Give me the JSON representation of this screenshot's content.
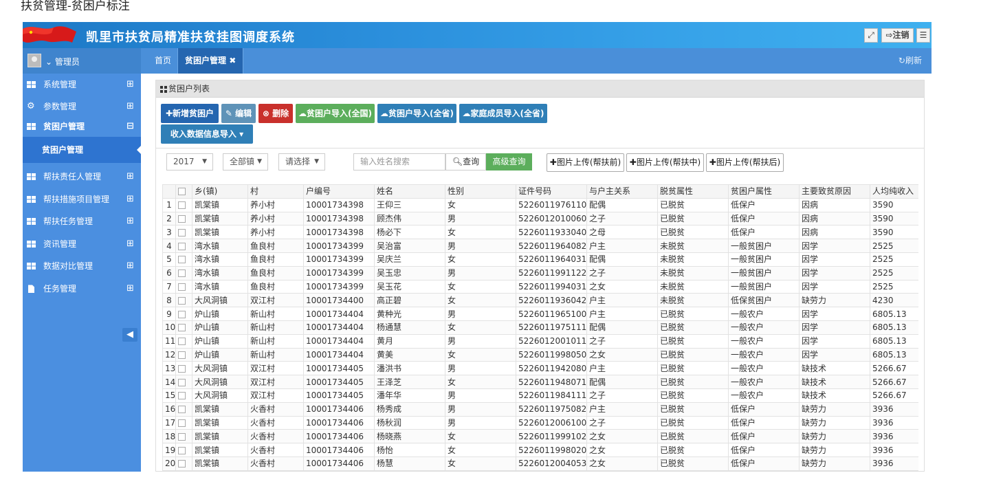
{
  "caption": "扶贫管理-贫困户标注",
  "header": {
    "title": "凯里市扶贫局精准扶贫挂图调度系统",
    "fullscreen_icon": "expand-icon",
    "logout_label": "注销",
    "menu_icon": "hamburger-icon"
  },
  "user": {
    "label": "管理员"
  },
  "tabs": {
    "home": "首页",
    "active": "贫困户管理"
  },
  "refresh": "刷新",
  "sidebar": {
    "items": [
      {
        "label": "系统管理"
      },
      {
        "label": "参数管理"
      },
      {
        "label": "贫困户管理"
      },
      {
        "label": "帮扶责任人管理"
      },
      {
        "label": "帮扶措施项目管理"
      },
      {
        "label": "帮扶任务管理"
      },
      {
        "label": "资讯管理"
      },
      {
        "label": "数据对比管理"
      },
      {
        "label": "任务管理"
      }
    ],
    "sub_active": "贫困户管理"
  },
  "panel": {
    "title": "贫困户列表"
  },
  "actions": {
    "add": "新增贫困户",
    "edit": "编辑",
    "delete": "删除",
    "import_all": "贫困户导入(全国)",
    "import_prov": "贫困户导入(全省)",
    "import_family": "家庭成员导入(全省)",
    "income": "收入数据信息导入"
  },
  "filters": {
    "year": "2017",
    "town": "全部镇",
    "choose": "请选择",
    "search_placeholder": "输入姓名搜索",
    "query": "查询",
    "advanced": "高级查询",
    "upload_before": "图片上传(帮扶前)",
    "upload_mid": "图片上传(帮扶中)",
    "upload_after": "图片上传(帮扶后)"
  },
  "table": {
    "headers": [
      "乡(镇)",
      "村",
      "户编号",
      "姓名",
      "性别",
      "证件号码",
      "与户主关系",
      "脱贫属性",
      "贫困户属性",
      "主要致贫原因",
      "人均纯收入"
    ],
    "rows": [
      [
        "1",
        "凯棠镇",
        "养小村",
        "10001734398",
        "王仰三",
        "女",
        "52260119761104",
        "配偶",
        "已脱贫",
        "低保户",
        "因病",
        "3590"
      ],
      [
        "2",
        "凯棠镇",
        "养小村",
        "10001734398",
        "顾杰伟",
        "男",
        "52260120100605(",
        "之子",
        "已脱贫",
        "低保户",
        "因病",
        "3590"
      ],
      [
        "3",
        "凯棠镇",
        "养小村",
        "10001734398",
        "杨必下",
        "女",
        "52260119330408",
        "之母",
        "已脱贫",
        "低保户",
        "因病",
        "3590"
      ],
      [
        "4",
        "湾水镇",
        "鱼良村",
        "10001734399",
        "吴治富",
        "男",
        "52260119640826",
        "户主",
        "未脱贫",
        "一般贫困户",
        "因学",
        "2525"
      ],
      [
        "5",
        "湾水镇",
        "鱼良村",
        "10001734399",
        "吴庆兰",
        "女",
        "52260119640310",
        "配偶",
        "未脱贫",
        "一般贫困户",
        "因学",
        "2525"
      ],
      [
        "6",
        "湾水镇",
        "鱼良村",
        "10001734399",
        "吴玉忠",
        "男",
        "52260119911228",
        "之子",
        "未脱贫",
        "一般贫困户",
        "因学",
        "2525"
      ],
      [
        "7",
        "湾水镇",
        "鱼良村",
        "10001734399",
        "吴玉花",
        "女",
        "52260119940312",
        "之女",
        "未脱贫",
        "一般贫困户",
        "因学",
        "2525"
      ],
      [
        "8",
        "大风洞镇",
        "双江村",
        "10001734400",
        "高正碧",
        "女",
        "52260119360426",
        "户主",
        "未脱贫",
        "低保贫困户",
        "缺劳力",
        "4230"
      ],
      [
        "9",
        "炉山镇",
        "新山村",
        "10001734404",
        "黄种光",
        "男",
        "52260119651006",
        "户主",
        "已脱贫",
        "一般农户",
        "因学",
        "6805.13"
      ],
      [
        "10",
        "炉山镇",
        "新山村",
        "10001734404",
        "杨通慧",
        "女",
        "52260119751113",
        "配偶",
        "已脱贫",
        "一般农户",
        "因学",
        "6805.13"
      ],
      [
        "11",
        "炉山镇",
        "新山村",
        "10001734404",
        "黄月",
        "男",
        "52260120010115",
        "之子",
        "已脱贫",
        "一般农户",
        "因学",
        "6805.13"
      ],
      [
        "12",
        "炉山镇",
        "新山村",
        "10001734404",
        "黄美",
        "女",
        "52260119980504",
        "之女",
        "已脱贫",
        "一般农户",
        "因学",
        "6805.13"
      ],
      [
        "13",
        "大风洞镇",
        "双江村",
        "10001734405",
        "潘洪书",
        "男",
        "52260119420807",
        "户主",
        "已脱贫",
        "一般农户",
        "缺技术",
        "5266.67"
      ],
      [
        "14",
        "大风洞镇",
        "双江村",
        "10001734405",
        "王泽芝",
        "女",
        "52260119480714",
        "配偶",
        "已脱贫",
        "一般农户",
        "缺技术",
        "5266.67"
      ],
      [
        "15",
        "大风洞镇",
        "双江村",
        "10001734405",
        "潘年华",
        "男",
        "52260119841110",
        "之子",
        "已脱贫",
        "一般农户",
        "缺技术",
        "5266.67"
      ],
      [
        "16",
        "凯棠镇",
        "火香村",
        "10001734406",
        "杨秀成",
        "男",
        "52260119750828",
        "户主",
        "已脱贫",
        "低保户",
        "缺劳力",
        "3936"
      ],
      [
        "17",
        "凯棠镇",
        "火香村",
        "10001734406",
        "杨秋润",
        "男",
        "52260120061006(",
        "之子",
        "已脱贫",
        "低保户",
        "缺劳力",
        "3936"
      ],
      [
        "18",
        "凯棠镇",
        "火香村",
        "10001734406",
        "杨晓燕",
        "女",
        "52260119991026(",
        "之女",
        "已脱贫",
        "低保户",
        "缺劳力",
        "3936"
      ],
      [
        "19",
        "凯棠镇",
        "火香村",
        "10001734406",
        "杨怡",
        "女",
        "52260119980206",
        "之女",
        "已脱贫",
        "低保户",
        "缺劳力",
        "3936"
      ],
      [
        "20",
        "凯棠镇",
        "火香村",
        "10001734406",
        "杨慧",
        "女",
        "52260120040530(",
        "之女",
        "已脱贫",
        "低保户",
        "缺劳力",
        "3936"
      ]
    ]
  }
}
